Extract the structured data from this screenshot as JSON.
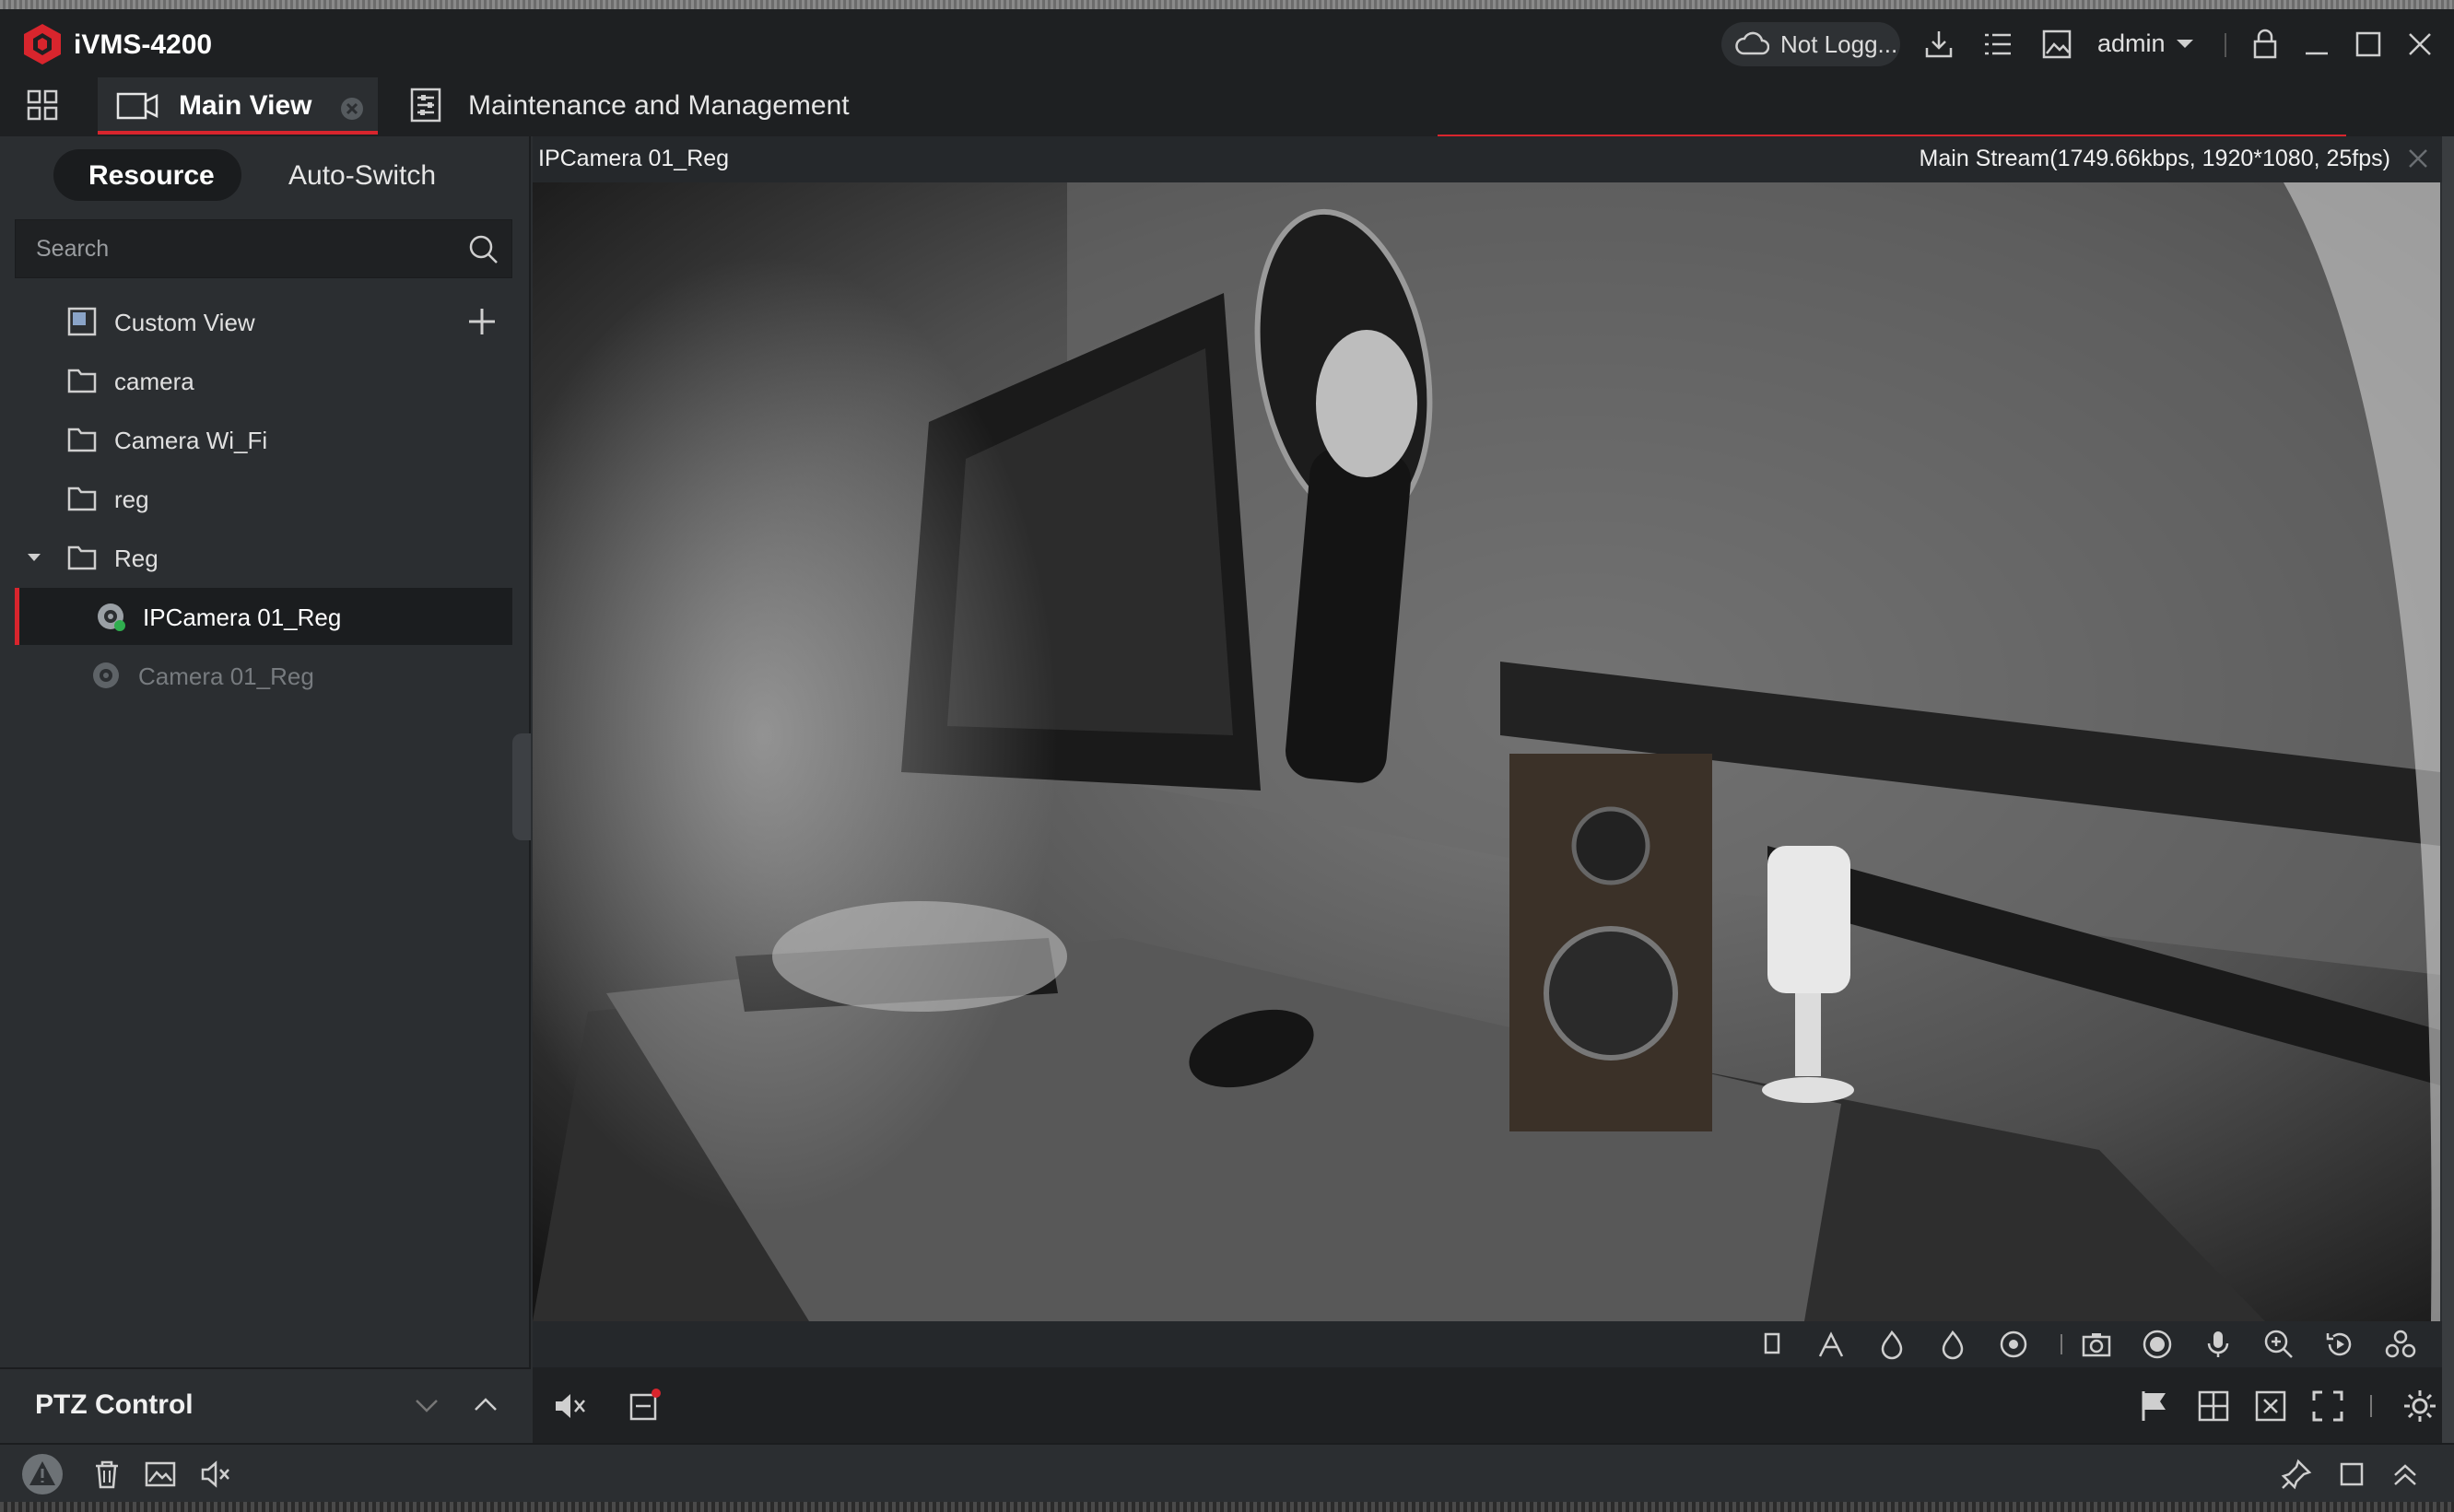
{
  "app": {
    "title": "iVMS-4200",
    "cloud_status": "Not Logg...",
    "user": "admin"
  },
  "tabs": {
    "main_view": "Main View",
    "maintenance": "Maintenance and Management"
  },
  "left": {
    "segments": {
      "resource": "Resource",
      "auto_switch": "Auto-Switch"
    },
    "search_placeholder": "Search",
    "tree": [
      {
        "label": "Custom View",
        "icon": "custom-view-icon"
      },
      {
        "label": "camera",
        "icon": "folder-icon"
      },
      {
        "label": "Camera Wi_Fi",
        "icon": "folder-icon"
      },
      {
        "label": "reg",
        "icon": "folder-icon"
      },
      {
        "label": "Reg",
        "icon": "folder-icon",
        "expanded": true
      },
      {
        "label": "IPCamera 01_Reg",
        "icon": "camera-online-icon",
        "selected": true
      },
      {
        "label": "Camera 01_Reg",
        "icon": "camera-offline-icon"
      }
    ],
    "ptz_label": "PTZ Control"
  },
  "video": {
    "camera_name": "IPCamera 01_Reg",
    "stream_info": "Main Stream(1749.66kbps, 1920*1080, 25fps)"
  },
  "colors": {
    "accent": "#d8252d",
    "bg": "#2b2e31",
    "titlebar": "#1e2022"
  }
}
